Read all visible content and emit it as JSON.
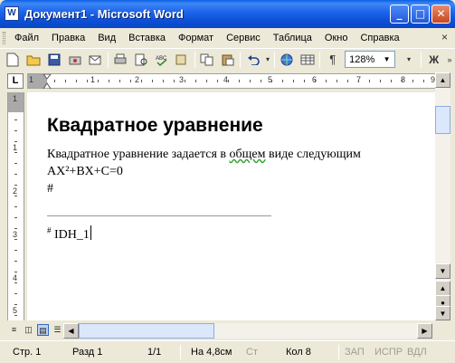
{
  "window": {
    "title": "Документ1 - Microsoft Word",
    "app_icon_letter": "W"
  },
  "menu": {
    "items": [
      "Файл",
      "Правка",
      "Вид",
      "Вставка",
      "Формат",
      "Сервис",
      "Таблица",
      "Окно",
      "Справка"
    ],
    "close_glyph": "×"
  },
  "toolbar": {
    "zoom": "128%",
    "paragraph_mark": "¶",
    "bold_label": "Ж"
  },
  "ruler": {
    "tab_selector": "L",
    "h_numbers": [
      "1",
      "1",
      "2",
      "3",
      "4",
      "5",
      "6",
      "7",
      "8",
      "9"
    ],
    "v_numbers": [
      "1",
      "1",
      "2",
      "3",
      "4",
      "5"
    ]
  },
  "document": {
    "heading": "Квадратное уравнение",
    "line1_before": "Квадратное уравнение задается в ",
    "line1_flag": "общем",
    "line1_after": " виде следующим",
    "line2": "AX²+BX+C=0",
    "line3": "#",
    "footnote_mark": "#",
    "footnote_text": "IDH_1"
  },
  "status": {
    "page": "Стр. 1",
    "section": "Разд 1",
    "pages": "1/1",
    "position": "На 4,8см",
    "line": "Ст",
    "column": "Кол 8",
    "rec": "ЗАП",
    "trk": "ИСПР",
    "ext": "ВДЛ"
  }
}
